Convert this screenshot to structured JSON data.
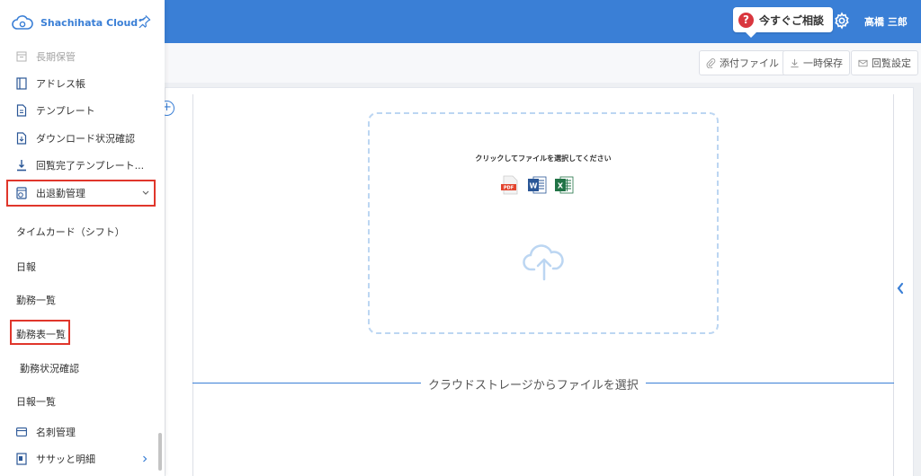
{
  "app": {
    "brand": "Shachihata Cloud",
    "brand_color": "#3a7fd6"
  },
  "header": {
    "consult_label": "今すぐご相談",
    "user_name": "高橋 三郎"
  },
  "toolbar": {
    "attach_label": "添付ファイル",
    "save_label": "一時保存",
    "circulation_label": "回覧設定"
  },
  "sidebar": {
    "items": [
      {
        "label": "長期保管",
        "icon": "archive-icon"
      },
      {
        "label": "アドレス帳",
        "icon": "address-book-icon"
      },
      {
        "label": "テンプレート",
        "icon": "document-icon"
      },
      {
        "label": "ダウンロード状況確認",
        "icon": "download-status-icon"
      },
      {
        "label": "回覧完了テンプレート...",
        "icon": "download-tray-icon"
      },
      {
        "label": "出退勤管理",
        "icon": "attendance-icon"
      }
    ],
    "subitems": [
      "タイムカード（シフト）",
      "日報",
      "勤務一覧",
      "勤務表一覧",
      "勤務状況確認",
      "日報一覧"
    ],
    "bottom_items": [
      {
        "label": "名刺管理",
        "icon": "card-icon"
      },
      {
        "label": "ササッと明細",
        "icon": "statement-icon"
      }
    ]
  },
  "upload": {
    "prompt": "クリックしてファイルを選択してください",
    "file_types": [
      "PDF",
      "W",
      "X"
    ],
    "cloud_label": "クラウドストレージからファイルを選択"
  },
  "colors": {
    "header": "#3a7fd6",
    "highlight": "#e0362b",
    "dropzone_border": "#bcd6f2"
  }
}
